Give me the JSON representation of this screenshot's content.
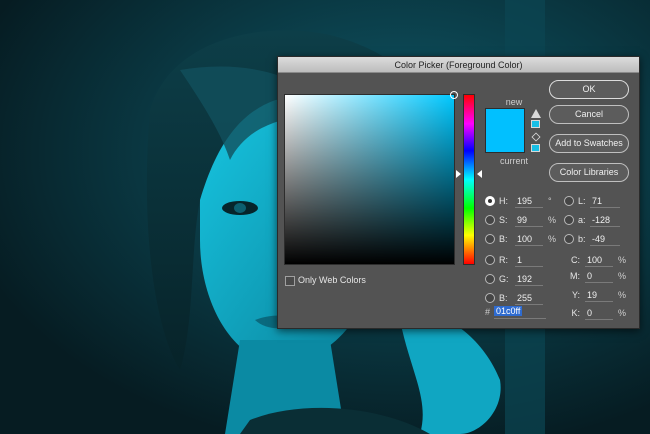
{
  "dialog": {
    "title": "Color Picker (Foreground Color)",
    "new_label": "new",
    "current_label": "current",
    "new_color": "#01c0ff",
    "only_web_colors_label": "Only Web Colors",
    "only_web_colors_checked": false
  },
  "buttons": {
    "ok": "OK",
    "cancel": "Cancel",
    "add_to_swatches": "Add to Swatches",
    "color_libraries": "Color Libraries"
  },
  "hsb": {
    "h_label": "H:",
    "h_value": "195",
    "h_unit": "°",
    "s_label": "S:",
    "s_value": "99",
    "s_unit": "%",
    "b_label": "B:",
    "b_value": "100",
    "b_unit": "%"
  },
  "rgb": {
    "r_label": "R:",
    "r_value": "1",
    "g_label": "G:",
    "g_value": "192",
    "b_label": "B:",
    "b_value": "255"
  },
  "lab": {
    "l_label": "L:",
    "l_value": "71",
    "a_label": "a:",
    "a_value": "-128",
    "b_label": "b:",
    "b_value": "-49"
  },
  "cmyk": {
    "c_label": "C:",
    "c_value": "100",
    "c_unit": "%",
    "m_label": "M:",
    "m_value": "0",
    "m_unit": "%",
    "y_label": "Y:",
    "y_value": "19",
    "y_unit": "%",
    "k_label": "K:",
    "k_value": "0",
    "k_unit": "%"
  },
  "hex": {
    "hash": "#",
    "value": "01c0ff"
  },
  "icons": {
    "gamut_warning": "warning-triangle-icon",
    "web_safe": "cube-icon"
  }
}
